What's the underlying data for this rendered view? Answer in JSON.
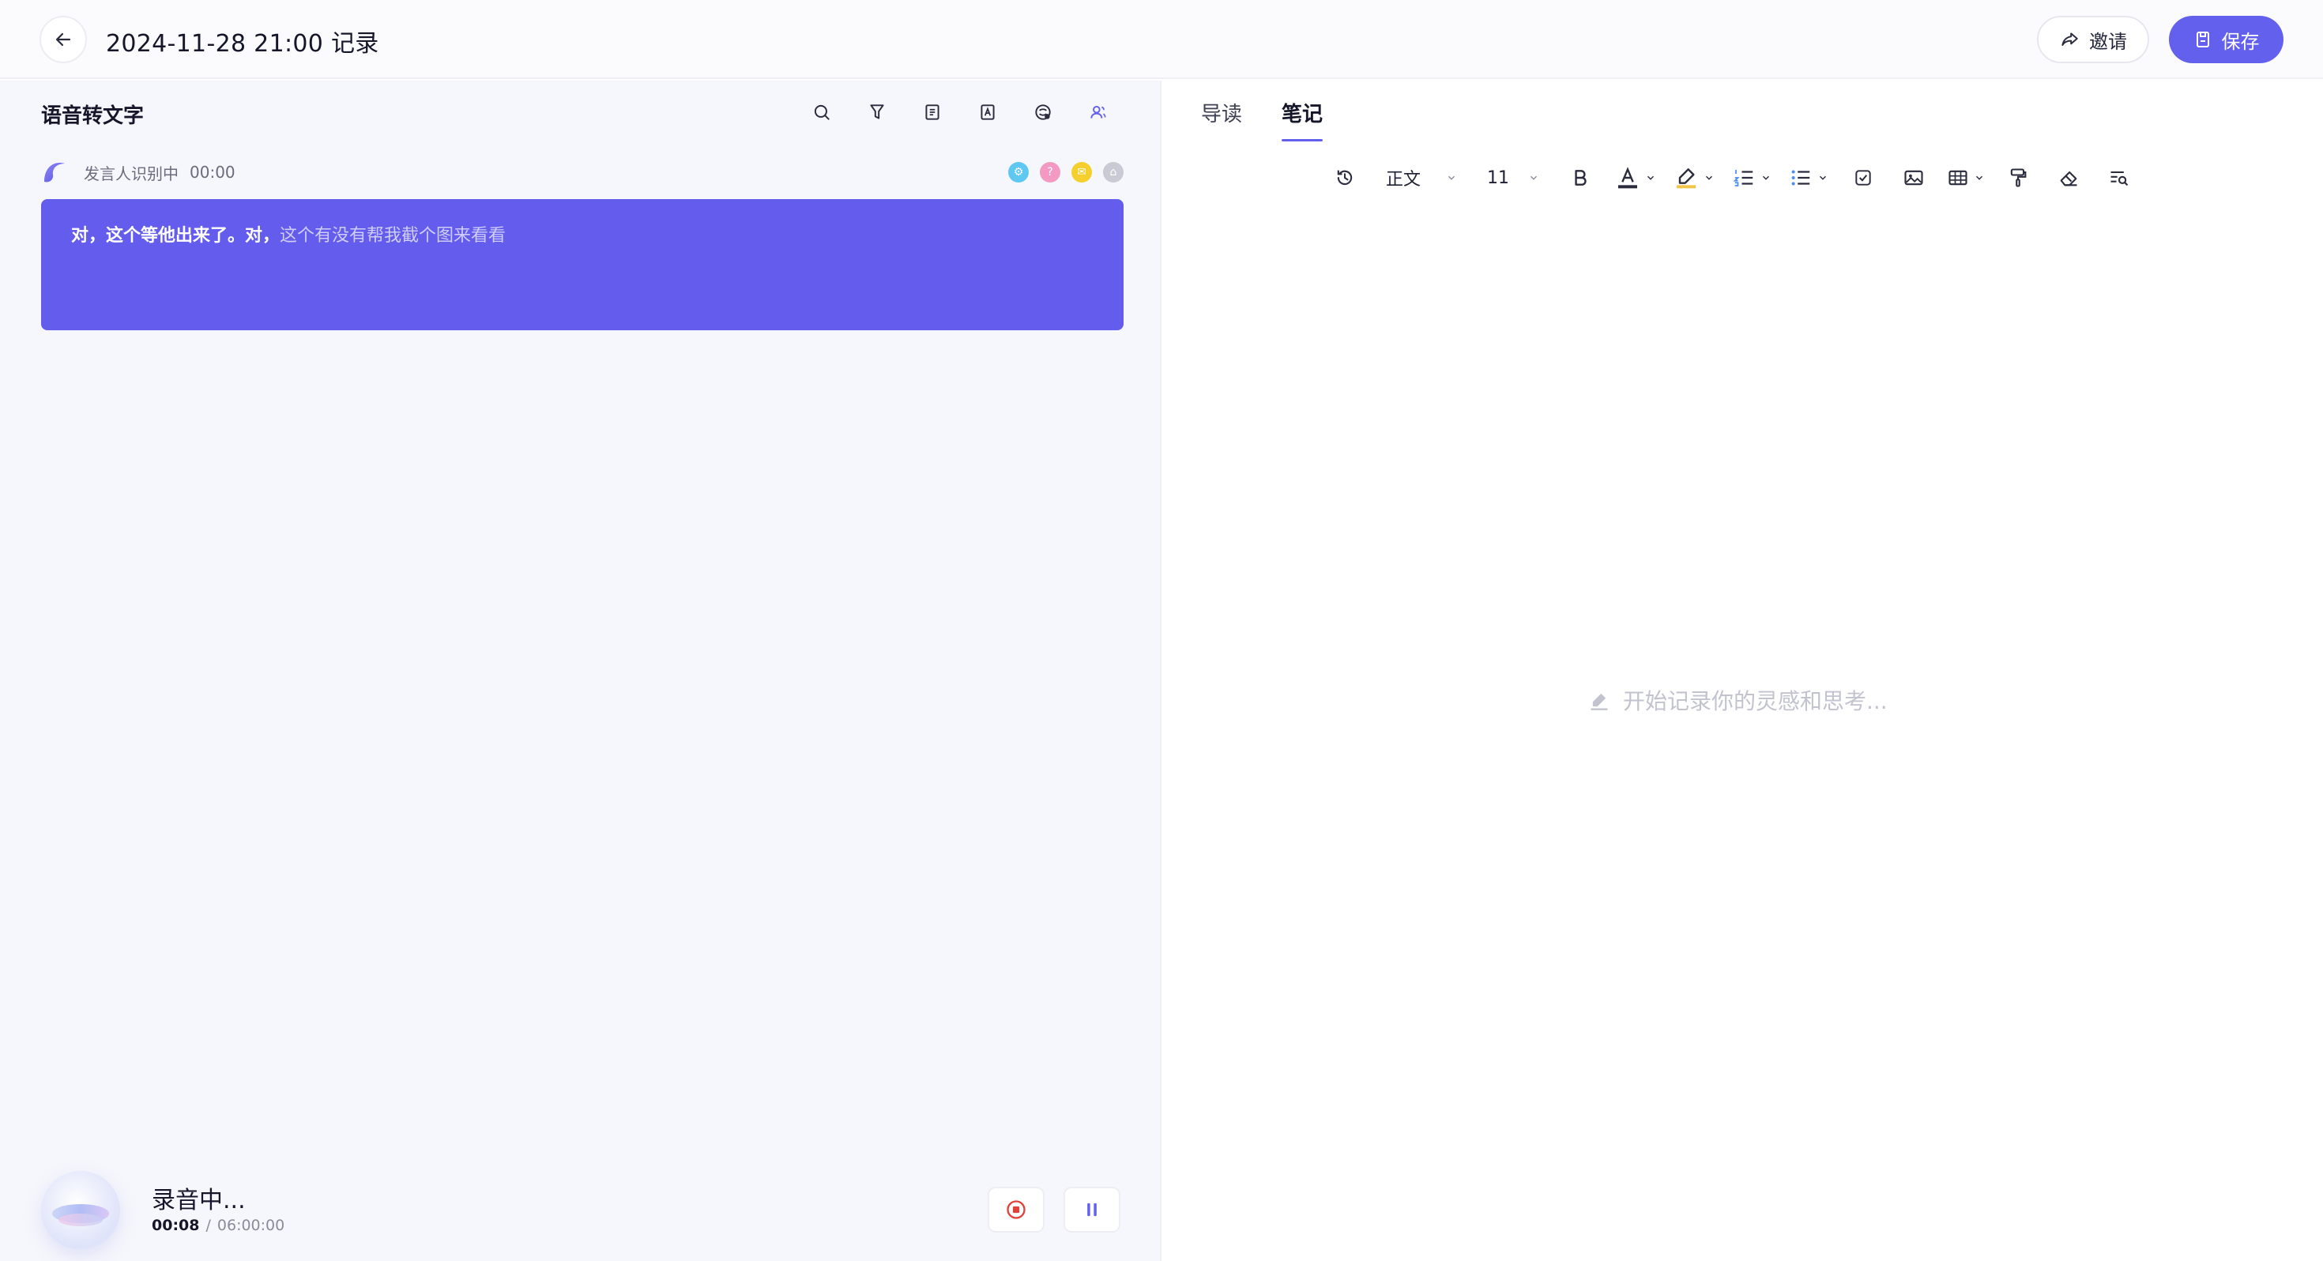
{
  "header": {
    "title": "2024-11-28 21:00 记录",
    "invite_label": "邀请",
    "save_label": "保存"
  },
  "transcript_panel": {
    "title": "语音转文字",
    "tools": [
      "search-icon",
      "filter-icon",
      "summary-icon",
      "text-icon",
      "translate-icon",
      "speaker-icon"
    ],
    "speaker": {
      "label": "发言人识别中",
      "time": "00:00",
      "dot_colors": [
        "#5ec8f2",
        "#f49ac2",
        "#f5cf2e",
        "#c9cad3"
      ]
    },
    "segment": {
      "text_strong": "对，这个等他出来了。对，",
      "text_soft": "这个有没有帮我截个图来看看"
    },
    "recording": {
      "status": "录音中...",
      "current": "00:08",
      "separator": "/",
      "total": "06:00:00"
    }
  },
  "notes_panel": {
    "tabs": [
      {
        "label": "导读",
        "active": false
      },
      {
        "label": "笔记",
        "active": true
      }
    ],
    "toolbar": {
      "style_label": "正文",
      "font_size": "11"
    },
    "placeholder": "开始记录你的灵感和思考..."
  },
  "colors": {
    "accent": "#6460ee",
    "card": "#635cec"
  }
}
